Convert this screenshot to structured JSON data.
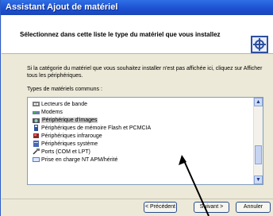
{
  "window": {
    "title": "Assistant Ajout de matériel"
  },
  "header": {
    "heading": "Sélectionnez dans cette liste le type du matériel que vous installez",
    "icon": "hardware-wizard-icon"
  },
  "body": {
    "info": "Si la catégorie du matériel que vous souhaitez installer n'est pas affichée ici, cliquez sur Afficher tous les périphériques.",
    "list_label": "Types de matériels communs :",
    "items": [
      {
        "label": "Lecteurs de bande",
        "icon": "tape-drive-icon"
      },
      {
        "label": "Modems",
        "icon": "modem-icon"
      },
      {
        "label": "Périphérique d'images",
        "icon": "camera-icon",
        "selected": true
      },
      {
        "label": "Périphériques de mémoire Flash et PCMCIA",
        "icon": "pcmcia-icon"
      },
      {
        "label": "Périphériques infrarouge",
        "icon": "infrared-icon"
      },
      {
        "label": "Périphériques système",
        "icon": "system-device-icon"
      },
      {
        "label": "Ports (COM et LPT)",
        "icon": "port-icon"
      },
      {
        "label": "Prise en charge NT APM/hérité",
        "icon": "power-icon"
      }
    ]
  },
  "buttons": {
    "back": "< Précédent",
    "next": "Suivant >",
    "cancel": "Annuler"
  }
}
